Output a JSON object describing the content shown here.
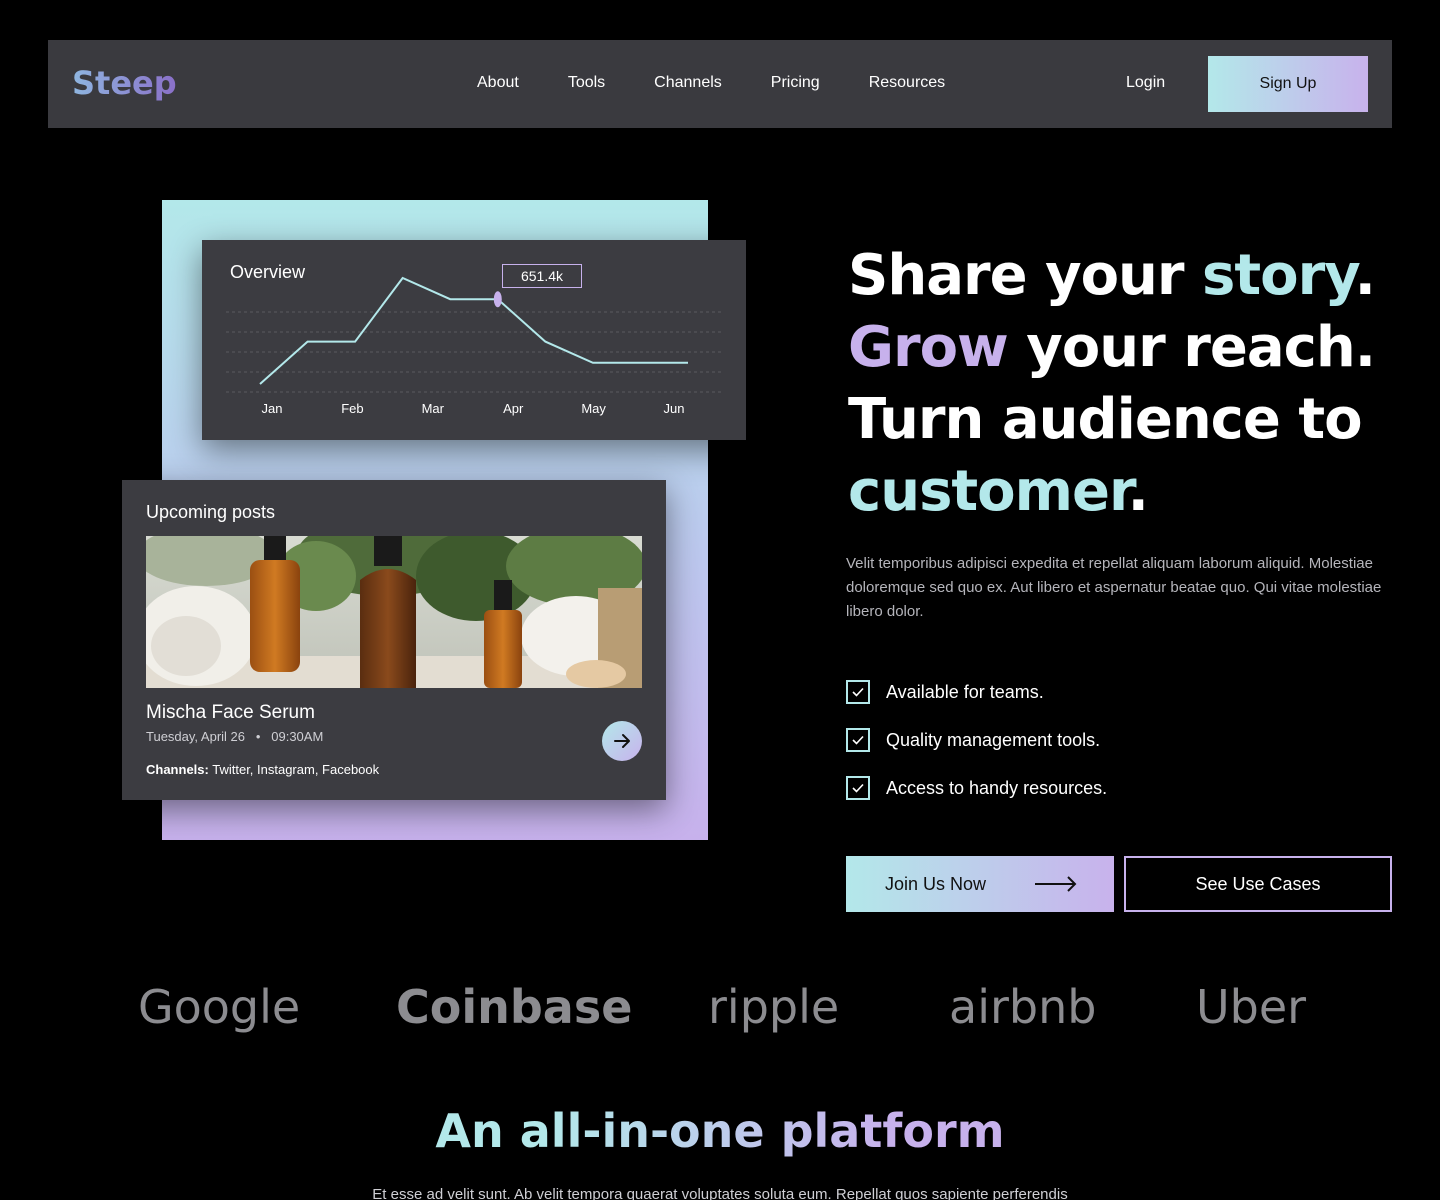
{
  "nav": {
    "logo": "Steep",
    "links": [
      "About",
      "Tools",
      "Channels",
      "Pricing",
      "Resources"
    ],
    "login": "Login",
    "signup": "Sign Up"
  },
  "overview": {
    "title": "Overview",
    "tooltip": "651.4k",
    "months": [
      "Jan",
      "Feb",
      "Mar",
      "Apr",
      "May",
      "Jun"
    ]
  },
  "posts": {
    "title": "Upcoming posts",
    "name": "Mischa Face Serum",
    "date": "Tuesday, April 26",
    "time": "09:30AM",
    "channels_label": "Channels:",
    "channels": "Twitter, Instagram, Facebook"
  },
  "hero": {
    "line1_a": "Share your ",
    "line1_b": "story",
    "line1_c": ".",
    "line2_a": "Grow",
    "line2_b": " your reach.",
    "line3": "Turn audience to",
    "line4_a": "customer",
    "line4_b": ".",
    "description": "Velit temporibus adipisci expedita et repellat aliquam laborum aliquid. Molestiae doloremque sed quo ex. Aut libero et aspernatur beatae quo. Qui vitae molestiae libero dolor."
  },
  "features": [
    "Available for teams.",
    "Quality management tools.",
    "Access to handy resources."
  ],
  "cta": {
    "join": "Join Us Now",
    "cases": "See Use Cases"
  },
  "brands": [
    "Google",
    "Coinbase",
    "ripple",
    "airbnb",
    "Uber"
  ],
  "section": {
    "title": "An all-in-one platform",
    "subtitle": "Et esse ad velit sunt. Ab velit tempora quaerat voluptates soluta eum. Repellat quos sapiente perferendis"
  },
  "colors": {
    "teal": "#b3e8ea",
    "purple": "#c7b1ec",
    "panel": "#3c3c41"
  },
  "chart_data": {
    "type": "line",
    "categories": [
      "Jan",
      "Feb",
      "Mar",
      "Apr",
      "May",
      "Jun"
    ],
    "values": [
      0,
      2,
      2,
      5,
      4,
      4,
      2,
      1,
      1,
      1
    ],
    "highlight": "651.4k",
    "grid": true
  }
}
